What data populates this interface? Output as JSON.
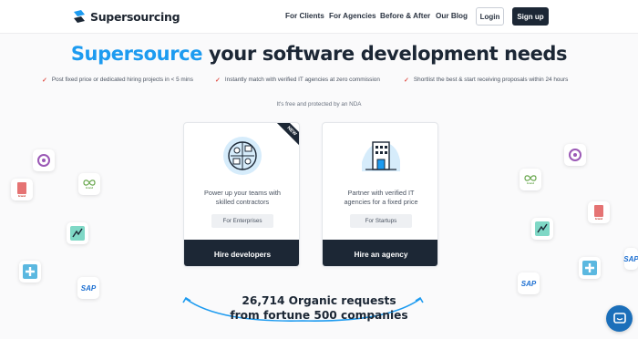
{
  "nav": {
    "brand": "Supersourcing",
    "links": [
      "For Clients",
      "For Agencies",
      "Before & After",
      "Our Blog"
    ],
    "login": "Login",
    "signup": "Sign up"
  },
  "hero": {
    "headline_accent": "Supersource",
    "headline_rest": " your software development needs",
    "bullets": [
      "Post fixed price or dedicated hiring projects in < 5 mins",
      "Instantly match with verified IT agencies at zero commission",
      "Shortlist the best & start receiving proposals within 24 hours"
    ],
    "nda_note": "It's free and protected by an NDA"
  },
  "cards": [
    {
      "description_line1": "Power up your teams with",
      "description_line2": "skilled contractors",
      "tag": "For Enterprises",
      "cta": "Hire developers",
      "ribbon": "NEW"
    },
    {
      "description_line1": "Partner with verified IT",
      "description_line2": "agencies for a fixed price",
      "tag": "For Startups",
      "cta": "Hire an agency"
    }
  ],
  "stats": {
    "line1": "26,714 Organic requests",
    "line2": "from fortune 500 companies"
  },
  "brands": {
    "sap": "SAP",
    "caption_green": "brand",
    "caption_red": "brand"
  },
  "colors": {
    "accent": "#1d9bf0",
    "dark": "#1c2735",
    "check": "#e0534a",
    "chat": "#1b6fba"
  },
  "icons": {
    "logo": "supersourcing-logo-icon",
    "check": "check-icon",
    "chat": "chat-bubble-icon"
  }
}
